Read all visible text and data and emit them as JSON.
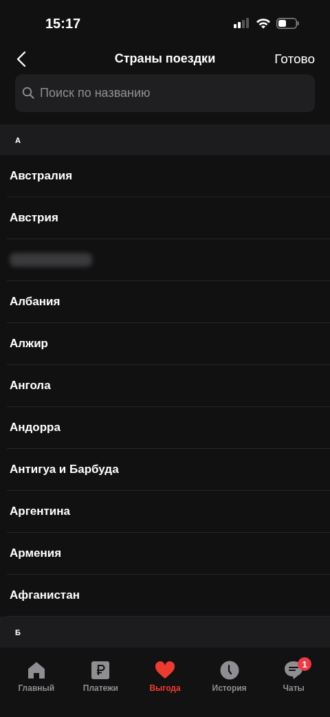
{
  "status_bar": {
    "time": "15:17"
  },
  "nav": {
    "title": "Страны поездки",
    "done": "Готово"
  },
  "search": {
    "placeholder": "Поиск по названию"
  },
  "sections": [
    {
      "letter": "А",
      "countries": [
        {
          "kind": "text",
          "name": "Австралия"
        },
        {
          "kind": "text",
          "name": "Австрия"
        },
        {
          "kind": "redacted"
        },
        {
          "kind": "text",
          "name": "Албания"
        },
        {
          "kind": "text",
          "name": "Алжир"
        },
        {
          "kind": "text",
          "name": "Ангола"
        },
        {
          "kind": "text",
          "name": "Андорра"
        },
        {
          "kind": "text",
          "name": "Антигуа и Барбуда"
        },
        {
          "kind": "text",
          "name": "Аргентина"
        },
        {
          "kind": "text",
          "name": "Армения"
        },
        {
          "kind": "text",
          "name": "Афганистан"
        }
      ]
    },
    {
      "letter": "Б"
    }
  ],
  "tab_bar": [
    {
      "kind": "home",
      "label": "Главный",
      "selected": false
    },
    {
      "kind": "payments",
      "label": "Платежи",
      "selected": false
    },
    {
      "kind": "benefits",
      "label": "Выгода",
      "selected": true
    },
    {
      "kind": "history",
      "label": "История",
      "selected": false
    },
    {
      "kind": "chats",
      "label": "Чаты",
      "selected": false,
      "badge": "1"
    }
  ]
}
